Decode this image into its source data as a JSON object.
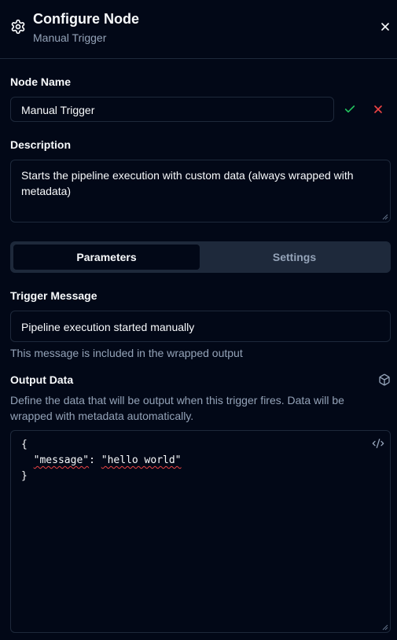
{
  "header": {
    "title": "Configure Node",
    "subtitle": "Manual Trigger",
    "icons": {
      "settings": "gear-icon",
      "close": "close-icon"
    }
  },
  "node_name": {
    "label": "Node Name",
    "value": "Manual Trigger",
    "confirm_icon": "check-icon",
    "cancel_icon": "x-icon"
  },
  "description": {
    "label": "Description",
    "value": "Starts the pipeline execution with custom data (always wrapped with metadata)"
  },
  "tabs": [
    {
      "label": "Parameters",
      "active": true
    },
    {
      "label": "Settings",
      "active": false
    }
  ],
  "trigger_message": {
    "label": "Trigger Message",
    "value": "Pipeline execution started manually",
    "help": "This message is included in the wrapped output"
  },
  "output_data": {
    "label": "Output Data",
    "help": "Define the data that will be output when this trigger fires. Data will be wrapped with metadata automatically.",
    "code": {
      "open_brace": "{",
      "key": "\"message\"",
      "colon": ": ",
      "value": "\"hello world\"",
      "close_brace": "}"
    },
    "icons": {
      "box": "package-icon",
      "code": "code-icon"
    }
  },
  "colors": {
    "background": "#020817",
    "border": "#1e293b",
    "muted_text": "#94a3b8",
    "confirm": "#22c55e",
    "cancel": "#ef4444"
  }
}
